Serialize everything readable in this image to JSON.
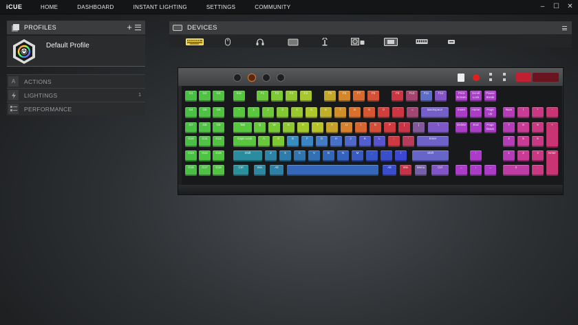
{
  "app": {
    "brand": "iCUE"
  },
  "nav": [
    "HOME",
    "DASHBOARD",
    "INSTANT LIGHTING",
    "SETTINGS",
    "COMMUNITY"
  ],
  "window_controls": {
    "minimize": "–",
    "maximize": "☐",
    "close": "✕"
  },
  "profiles": {
    "title": "PROFILES",
    "add": "+",
    "active_profile": "Default Profile"
  },
  "sidebar": {
    "items": [
      {
        "label": "ACTIONS",
        "count": ""
      },
      {
        "label": "LIGHTINGS",
        "count": "1"
      },
      {
        "label": "PERFORMANCE",
        "count": ""
      }
    ]
  },
  "devices": {
    "title": "DEVICES",
    "strip": [
      {
        "name": "keyboard-icon",
        "selected": true
      },
      {
        "name": "mouse-icon"
      },
      {
        "name": "headset-icon"
      },
      {
        "name": "mousepad-icon"
      },
      {
        "name": "headset-stand-icon"
      },
      {
        "name": "cooler-icon"
      },
      {
        "name": "lighting-node-icon"
      },
      {
        "name": "memory-icon"
      },
      {
        "name": "small-device-icon"
      }
    ]
  },
  "keyboard": {
    "gkeys": [
      "G1",
      "G2",
      "G3",
      "G4",
      "G5",
      "G6",
      "G7",
      "G8",
      "G9",
      "G10",
      "G11",
      "G12",
      "G13",
      "G14",
      "G15",
      "G16",
      "G17",
      "G18"
    ],
    "row_fn": [
      "Esc",
      "F1",
      "F2",
      "F3",
      "F4",
      "F5",
      "F6",
      "F7",
      "F8",
      "F9",
      "F10",
      "F11",
      "F12"
    ],
    "row_num": [
      "~",
      "1",
      "2",
      "3",
      "4",
      "5",
      "6",
      "7",
      "8",
      "9",
      "0",
      "-",
      "=",
      "Backspace"
    ],
    "row_tab": [
      "Tab",
      "Q",
      "W",
      "E",
      "R",
      "T",
      "Y",
      "U",
      "I",
      "O",
      "P",
      "[",
      "]",
      "\\"
    ],
    "row_caps": [
      "Caps Lock",
      "A",
      "S",
      "D",
      "F",
      "G",
      "H",
      "J",
      "K",
      "L",
      ";",
      "'",
      "Enter"
    ],
    "row_shift": [
      "Shift",
      "Z",
      "X",
      "C",
      "V",
      "B",
      "N",
      "M",
      ",",
      ".",
      "/",
      "Shift"
    ],
    "row_ctrl": [
      "Ctrl",
      "Win",
      "Alt",
      "",
      "Alt",
      "Win",
      "Menu",
      "Ctrl"
    ],
    "nav_block": [
      "Print Screen",
      "Scroll Lock",
      "Pause Break",
      "Insert",
      "Home",
      "Page Up",
      "Delete",
      "End",
      "Page Down"
    ],
    "arrows": [
      "↑",
      "←",
      "↓",
      "→"
    ],
    "numpad": [
      "Num",
      "/",
      "*",
      "-",
      "7",
      "8",
      "9",
      "+",
      "4",
      "5",
      "6",
      "1",
      "2",
      "3",
      "Enter",
      "0",
      "."
    ]
  }
}
